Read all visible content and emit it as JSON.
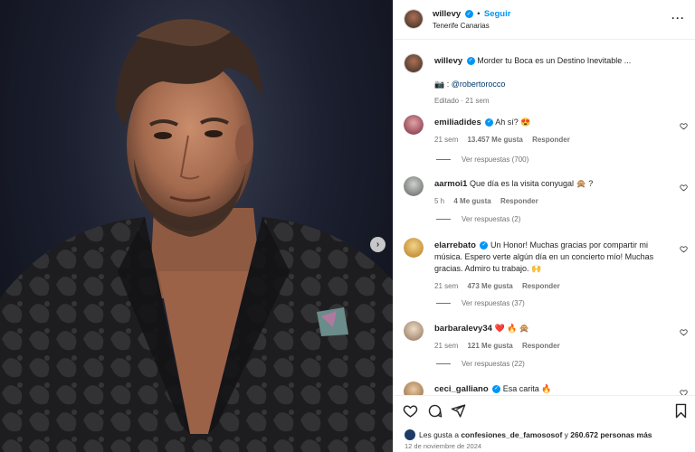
{
  "post": {
    "author": "willevy",
    "follow_label": "Seguir",
    "separator": "•",
    "location": "Tenerife Canarias",
    "more_label": "···",
    "caption_author": "willevy",
    "caption_text": "Morder tu Boca es un Destino Inevitable ...",
    "credit_prefix": "📷 :",
    "credit_handle": "@robertorocco",
    "edited_label": "Editado · 21 sem"
  },
  "comments": [
    {
      "user": "emiliadides",
      "verified": true,
      "text": "Ah sí? 😍",
      "time": "21 sem",
      "likes": "13.457 Me gusta",
      "reply_label": "Responder",
      "replies": "Ver respuestas (700)",
      "avatar_color": "#b35a6b"
    },
    {
      "user": "aarmoi1",
      "verified": false,
      "text": "Que día es la visita conyugal 🙊 ?",
      "time": "5 h",
      "likes": "4 Me gusta",
      "reply_label": "Responder",
      "replies": "Ver respuestas (2)",
      "avatar_color": "#8a8f8a"
    },
    {
      "user": "elarrebato",
      "verified": true,
      "text": "Un Honor! Muchas gracias por compartir mi música. Espero verte algún día en un concierto mío! Muchas gracias. Admiro tu trabajo. 🙌",
      "time": "21 sem",
      "likes": "473 Me gusta",
      "reply_label": "Responder",
      "replies": "Ver respuestas (37)",
      "avatar_color": "#d9a441"
    },
    {
      "user": "barbaralevy34",
      "verified": false,
      "text": "❤️ 🔥 🙊",
      "time": "21 sem",
      "likes": "121 Me gusta",
      "reply_label": "Responder",
      "replies": "Ver respuestas (22)",
      "avatar_color": "#c9b39a"
    },
    {
      "user": "ceci_galliano",
      "verified": true,
      "text": "Esa carita 🔥",
      "avatar_color": "#caa27a"
    }
  ],
  "footer": {
    "likes_prefix": "Les gusta a",
    "likes_user": "confesiones_de_famososof",
    "likes_and": "y",
    "likes_count": "260.672 personas más",
    "date": "12 de noviembre de 2024"
  },
  "icons": [
    "heart-icon",
    "comment-icon",
    "share-icon",
    "bookmark-icon",
    "verified-icon",
    "more-icon",
    "next-arrow-icon"
  ],
  "colors": {
    "accent": "#0095f6",
    "verified": "#0095f6",
    "muted": "#737373",
    "text": "#262626"
  }
}
